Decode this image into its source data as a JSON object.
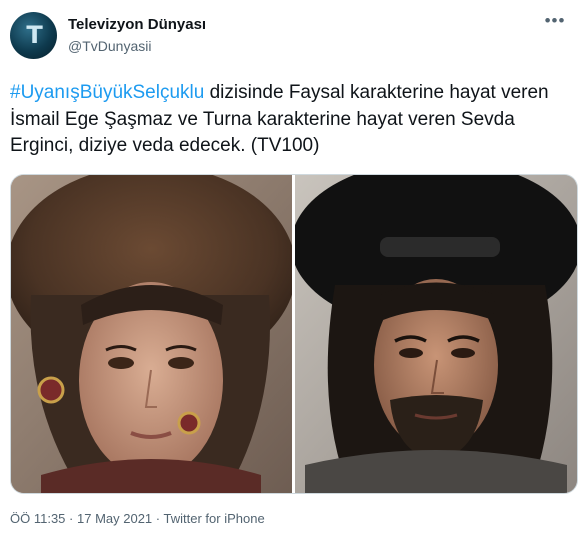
{
  "tweet": {
    "author": {
      "display_name": "Televizyon Dünyası",
      "handle": "@TvDunyasii",
      "avatar_glyph": "T"
    },
    "more_icon": "more-horizontal-icon",
    "hashtag": "#UyanışBüyükSelçuklu",
    "text_after_hashtag": " dizisinde Faysal karakterine hayat veren İsmail Ege Şaşmaz ve Turna karakterine hayat veren Sevda Erginci, diziye veda edecek. (TV100)",
    "media": [
      {
        "name": "photo-turna"
      },
      {
        "name": "photo-faysal"
      }
    ],
    "time": "ÖÖ 11:35",
    "date": "17 May 2021",
    "source": "Twitter for iPhone",
    "separator": "·"
  },
  "colors": {
    "link": "#1d9bf0",
    "text": "#0f1419",
    "secondary": "#536471",
    "border": "#cfd9de"
  }
}
